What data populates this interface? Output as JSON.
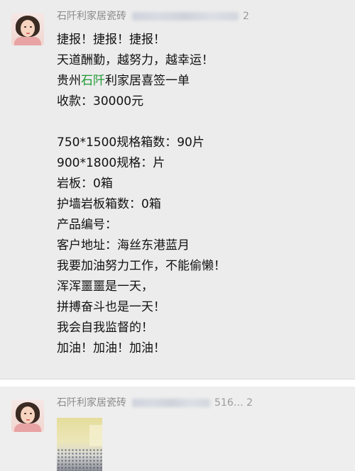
{
  "posts": [
    {
      "author": "石阡利家居瓷砖",
      "header_tail": "2",
      "lines": [
        "捷报！捷报！捷报！",
        "天道酬勤，越努力，越幸运！",
        {
          "pre": "贵州",
          "green": "石阡",
          "post": "利家居喜签一单"
        },
        "收款：30000元",
        "",
        "750*1500规格箱数：90片",
        "900*1800规格：片",
        "岩板：0箱",
        "护墙岩板箱数：0箱",
        "产品编号：",
        "客户地址：海丝东港蓝月",
        "我要加油努力工作，不能偷懒！",
        "浑浑噩噩是一天，",
        "拼搏奋斗也是一天！",
        "我会自我监督的！",
        "加油！加油！加油！"
      ]
    },
    {
      "author": "石阡利家居瓷砖",
      "header_tail": "516… 2"
    }
  ],
  "msg": {
    "l1": "捷报！捷报！捷报！",
    "l2": "天道酬勤，越努力，越幸运！",
    "l3_pre": "贵州",
    "l3_green": "石阡",
    "l3_post": "利家居喜签一单",
    "l4": "收款：30000元",
    "l6": "750*1500规格箱数：90片",
    "l7": "900*1800规格：片",
    "l8": "岩板：0箱",
    "l9": "护墙岩板箱数：0箱",
    "l10": "产品编号：",
    "l11": "客户地址：海丝东港蓝月",
    "l12": "我要加油努力工作，不能偷懒！",
    "l13": "浑浑噩噩是一天，",
    "l14": "拼搏奋斗也是一天！",
    "l15": "我会自我监督的！",
    "l16": "加油！加油！加油！"
  },
  "colors": {
    "highlight": "#1f9a34",
    "post_bg": "#ececec",
    "author": "#8a8a8a"
  },
  "icons": {
    "avatar": "profile-photo",
    "attachment": "photo-thumbnail"
  }
}
